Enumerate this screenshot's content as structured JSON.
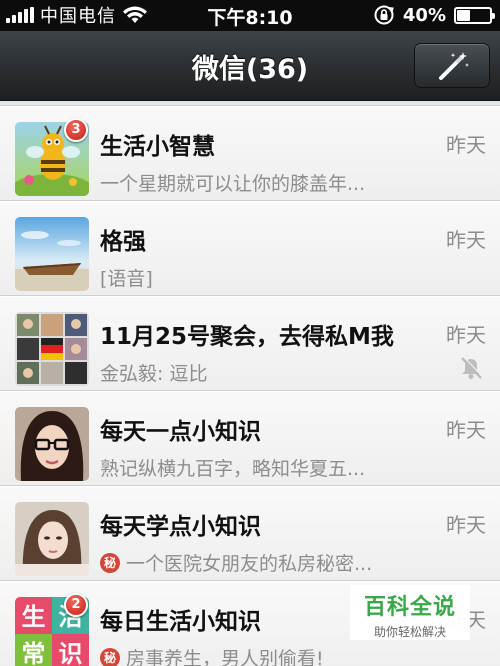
{
  "status_bar": {
    "carrier": "中国电信",
    "time": "下午8:10",
    "battery": "40%",
    "battery_level": 0.4,
    "icons": [
      "signal-icon",
      "wifi-icon",
      "rotation-lock-icon",
      "battery-icon"
    ]
  },
  "nav": {
    "title": "微信(36)",
    "compose_icon": "magic-wand-icon"
  },
  "chats": [
    {
      "name": "生活小智慧",
      "time": "昨天",
      "preview": "一个星期就可以让你的膝盖年...",
      "badge": "3",
      "avatar": "bee-cartoon-avatar"
    },
    {
      "name": "格强",
      "time": "昨天",
      "preview": "[语音]",
      "avatar": "boat-beach-avatar"
    },
    {
      "name": "11月25号聚会，去得私M我",
      "time": "昨天",
      "preview": "金弘毅: 逗比",
      "muted": true,
      "avatar": "group-grid-avatar"
    },
    {
      "name": "每天一点小知识",
      "time": "昨天",
      "preview": "熟记纵横九百字，略知华夏五...",
      "avatar": "girl-glasses-avatar"
    },
    {
      "name": "每天学点小知识",
      "time": "昨天",
      "mi_label": "秘",
      "preview": "一个医院女朋友的私房秘密...",
      "avatar": "girl-photo-avatar"
    },
    {
      "name": "每日生活小知识",
      "time": "昨天",
      "mi_label": "秘",
      "preview": "房事养生，男人别偷看!",
      "badge": "2",
      "avatar": "life-knowledge-avatar",
      "avatar_text": [
        "生",
        "活",
        "常",
        "识"
      ]
    }
  ],
  "watermark": {
    "title": "百科全说",
    "subtitle": "助你轻松解决"
  },
  "colors": {
    "badge": "#d6281c",
    "navbar": "#2a2e31",
    "watermark_green": "#3aa74a"
  }
}
